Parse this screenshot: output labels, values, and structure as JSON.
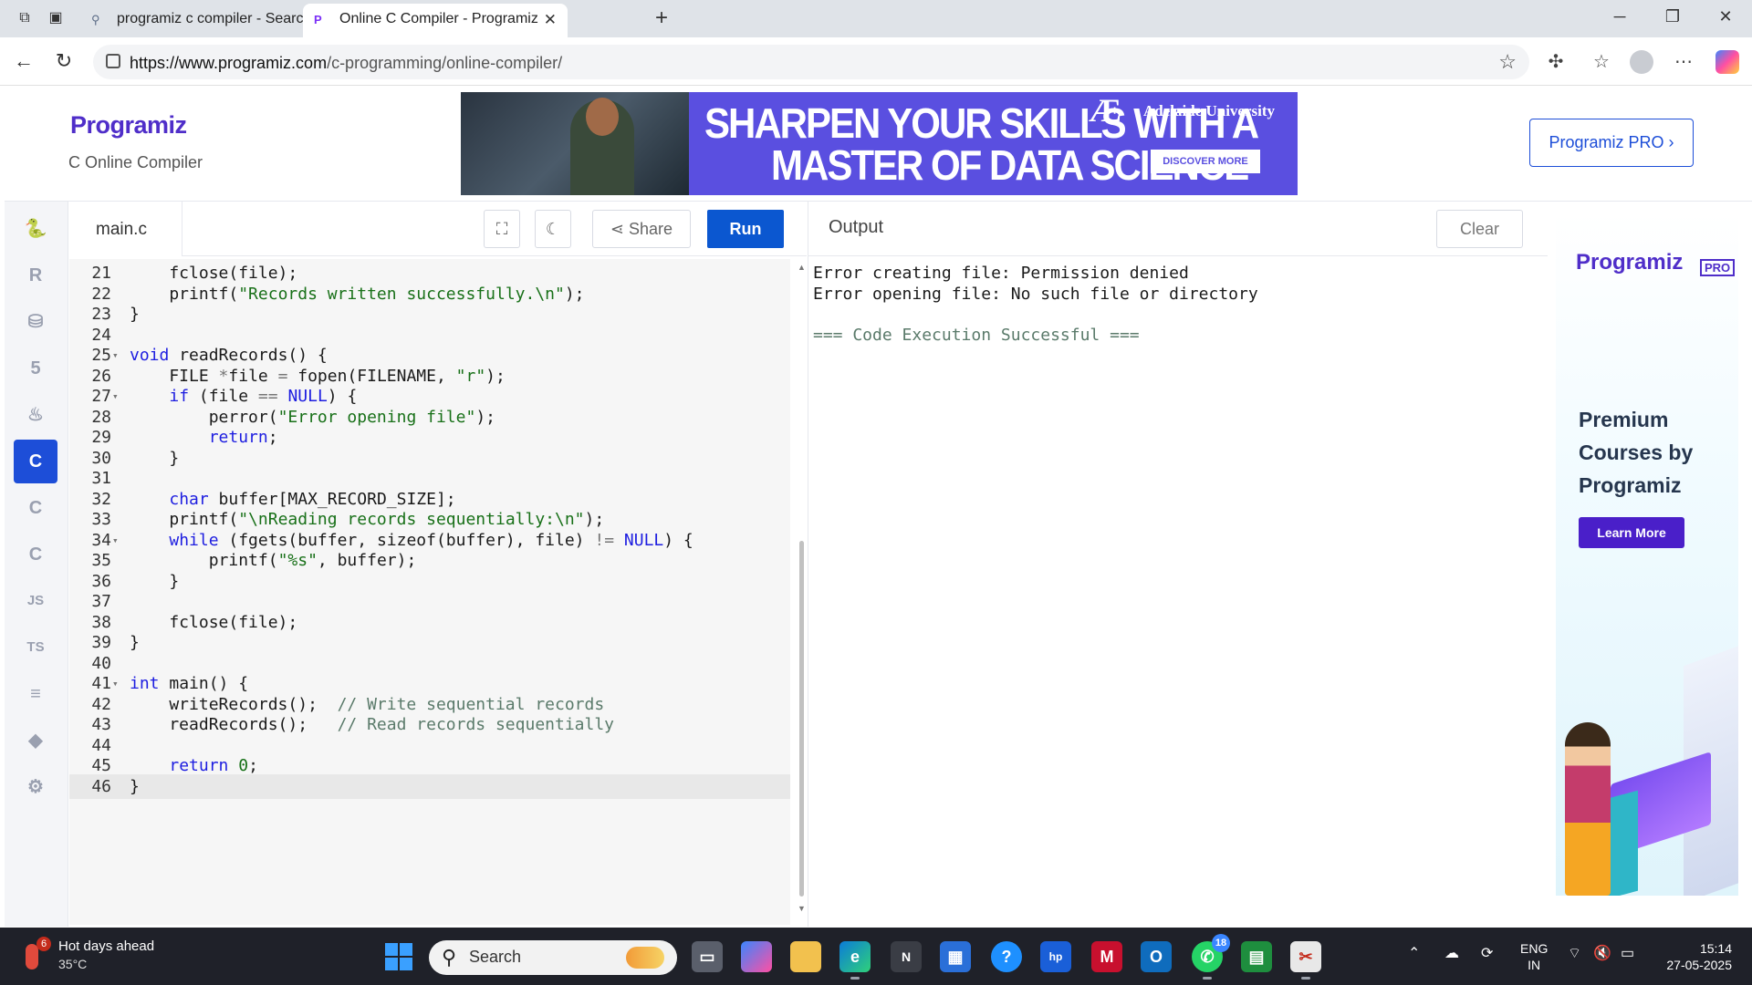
{
  "browser": {
    "tabs": [
      {
        "title": "programiz c compiler - Search"
      },
      {
        "title": "Online C Compiler - Programiz"
      }
    ],
    "url_host": "https://www.programiz.com",
    "url_path": "/c-programming/online-compiler/"
  },
  "header": {
    "logo": "Programiz",
    "subtitle": "C Online Compiler",
    "ad_line1": "SHARPEN YOUR SKILLS WITH A",
    "ad_line2": "MASTER OF DATA SCIENCE",
    "ad_university": "Adelaide University",
    "ad_cta": "DISCOVER MORE",
    "pro_button": "Programiz PRO ›"
  },
  "sidebar": {
    "items": [
      {
        "icon": "python-icon"
      },
      {
        "icon": "r-icon"
      },
      {
        "icon": "sql-icon"
      },
      {
        "icon": "html-icon"
      },
      {
        "icon": "java-icon"
      },
      {
        "icon": "c-icon",
        "active": true
      },
      {
        "icon": "cpp-icon"
      },
      {
        "icon": "csharp-icon"
      },
      {
        "icon": "js-icon",
        "label": "JS"
      },
      {
        "icon": "ts-icon",
        "label": "TS"
      },
      {
        "icon": "go-icon"
      },
      {
        "icon": "swift-icon"
      },
      {
        "icon": "rust-icon"
      }
    ]
  },
  "editor": {
    "filename": "main.c",
    "share_label": "Share",
    "run_label": "Run",
    "lines": [
      {
        "n": "21",
        "fold": false,
        "text": "    fclose(file);"
      },
      {
        "n": "22",
        "fold": false,
        "text": "    printf(\"Records written successfully.\\n\");"
      },
      {
        "n": "23",
        "fold": false,
        "text": "}"
      },
      {
        "n": "24",
        "fold": false,
        "text": ""
      },
      {
        "n": "25",
        "fold": true,
        "text": "void readRecords() {"
      },
      {
        "n": "26",
        "fold": false,
        "text": "    FILE *file = fopen(FILENAME, \"r\");"
      },
      {
        "n": "27",
        "fold": true,
        "text": "    if (file == NULL) {"
      },
      {
        "n": "28",
        "fold": false,
        "text": "        perror(\"Error opening file\");"
      },
      {
        "n": "29",
        "fold": false,
        "text": "        return;"
      },
      {
        "n": "30",
        "fold": false,
        "text": "    }"
      },
      {
        "n": "31",
        "fold": false,
        "text": ""
      },
      {
        "n": "32",
        "fold": false,
        "text": "    char buffer[MAX_RECORD_SIZE];"
      },
      {
        "n": "33",
        "fold": false,
        "text": "    printf(\"\\nReading records sequentially:\\n\");"
      },
      {
        "n": "34",
        "fold": true,
        "text": "    while (fgets(buffer, sizeof(buffer), file) != NULL) {"
      },
      {
        "n": "35",
        "fold": false,
        "text": "        printf(\"%s\", buffer);"
      },
      {
        "n": "36",
        "fold": false,
        "text": "    }"
      },
      {
        "n": "37",
        "fold": false,
        "text": ""
      },
      {
        "n": "38",
        "fold": false,
        "text": "    fclose(file);"
      },
      {
        "n": "39",
        "fold": false,
        "text": "}"
      },
      {
        "n": "40",
        "fold": false,
        "text": ""
      },
      {
        "n": "41",
        "fold": true,
        "text": "int main() {"
      },
      {
        "n": "42",
        "fold": false,
        "text": "    writeRecords();  // Write sequential records"
      },
      {
        "n": "43",
        "fold": false,
        "text": "    readRecords();   // Read records sequentially"
      },
      {
        "n": "44",
        "fold": false,
        "text": ""
      },
      {
        "n": "45",
        "fold": false,
        "text": "    return 0;"
      },
      {
        "n": "46",
        "fold": false,
        "text": "}",
        "current": true
      }
    ]
  },
  "output": {
    "title": "Output",
    "clear_label": "Clear",
    "lines": [
      {
        "text": "Error creating file: Permission denied",
        "kind": "normal"
      },
      {
        "text": "Error opening file: No such file or directory",
        "kind": "normal"
      },
      {
        "text": "",
        "kind": "normal"
      },
      {
        "text": "=== Code Execution Successful ===",
        "kind": "ok"
      }
    ]
  },
  "right_ad": {
    "logo": "Programiz",
    "badge": "PRO",
    "headline_1": "Premium",
    "headline_2": "Courses by",
    "headline_3": "Programiz",
    "cta": "Learn More"
  },
  "taskbar": {
    "weather_title": "Hot days ahead",
    "weather_temp": "35°C",
    "weather_badge": "6",
    "search_label": "Search",
    "whatsapp_badge": "18",
    "lang_1": "ENG",
    "lang_2": "IN",
    "time": "15:14",
    "date": "27-05-2025"
  },
  "colors": {
    "accent": "#0b57d0",
    "brand": "#4f2ec9",
    "keyword": "#1d1de0",
    "string": "#187018",
    "comment": "#5a7a6a"
  }
}
